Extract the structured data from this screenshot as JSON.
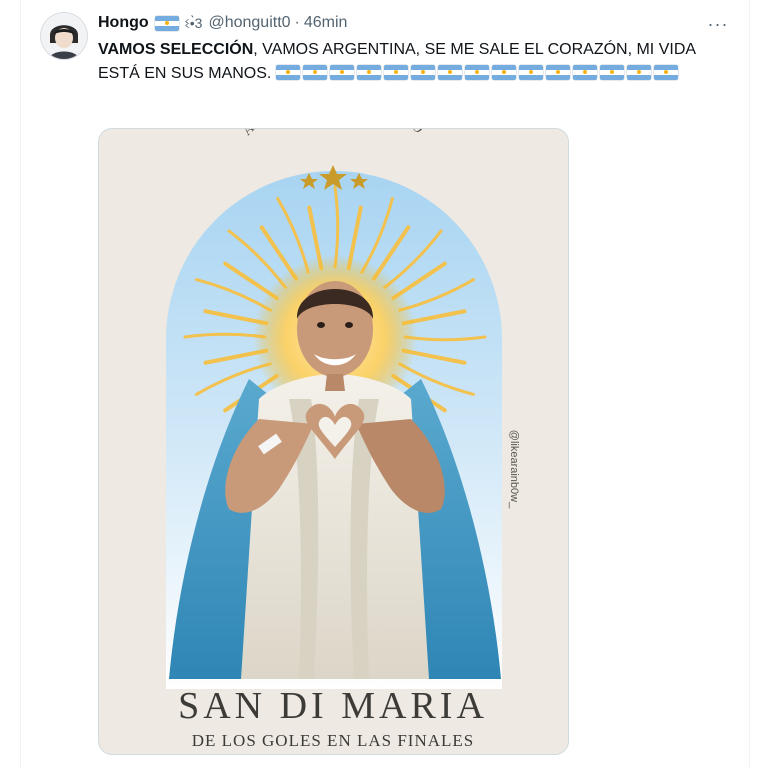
{
  "tweet": {
    "display_name": "Hongo",
    "name_emoji": "ଽ•̀3",
    "handle": "@honguitt0",
    "separator": "·",
    "time": "46min",
    "more_label": "···",
    "text_bold": "VAMOS SELECCIÓN",
    "text_rest": ", VAMOS ARGENTINA, SE ME SALE EL CORAZÓN, MI VIDA ESTÁ EN SUS MANOS.",
    "flag_count": 15
  },
  "image": {
    "arc_text": "ASÍ ESTABA ESCRITO",
    "watermark": "@likearainb0w_",
    "title": "SAN DI MARIA",
    "subtitle": "DE LOS GOLES EN LAS FINALES"
  },
  "colors": {
    "flag_blue": "#74acdf",
    "flag_sun": "#f6b40e",
    "card_bg": "#eeeae3",
    "arch_blue": "#8ec6ea",
    "text_dark": "#3d3b37"
  }
}
